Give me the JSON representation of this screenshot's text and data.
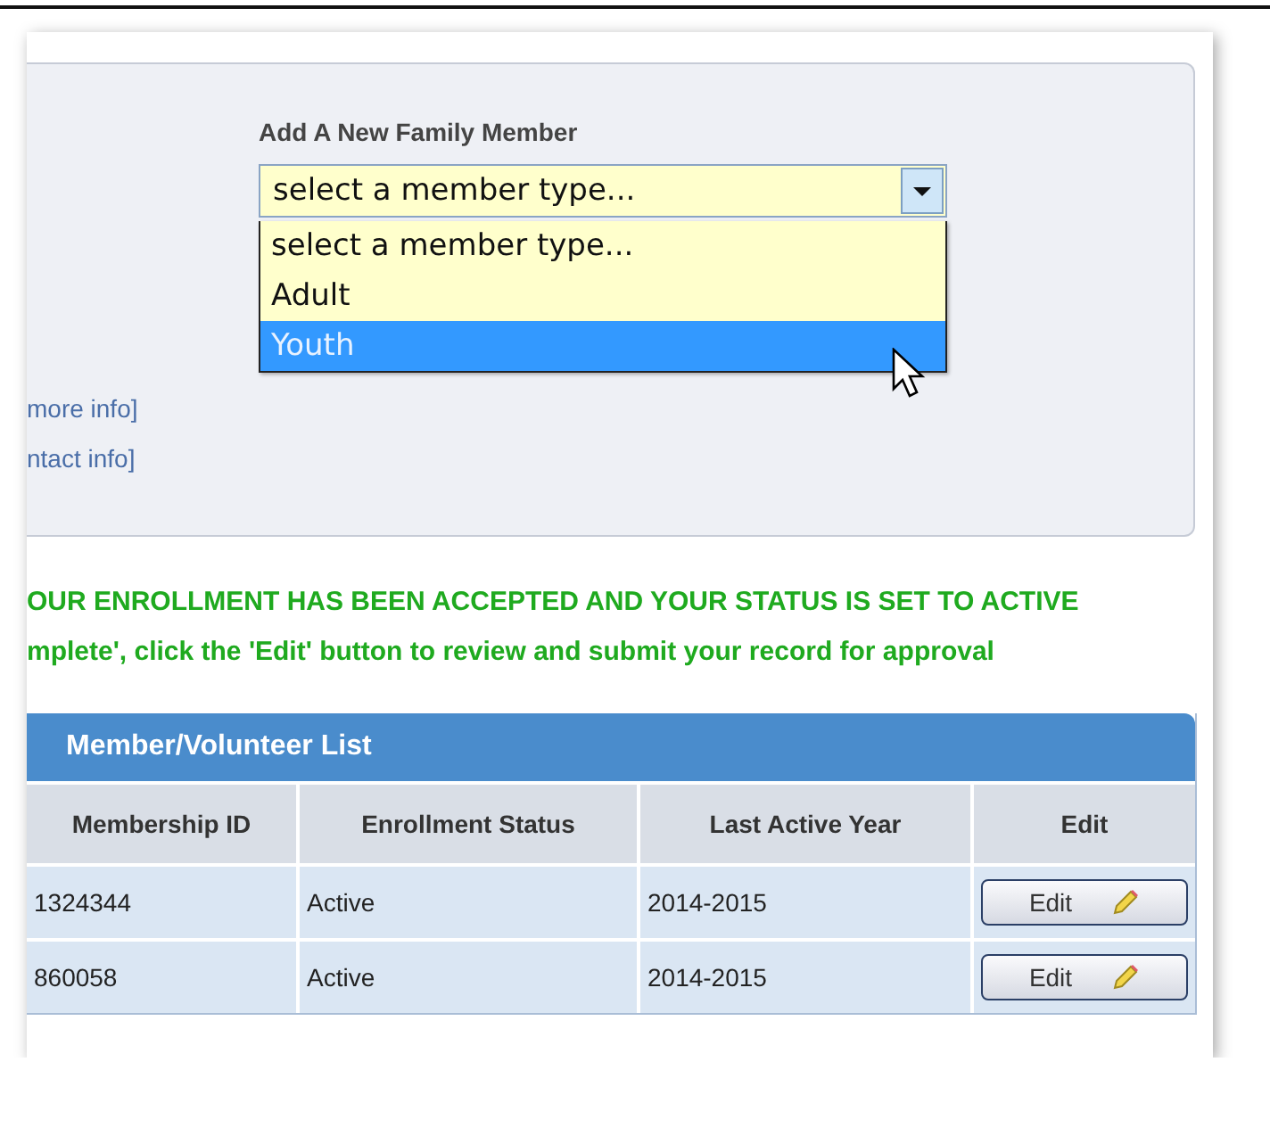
{
  "family_panel": {
    "label": "Add A New Family Member",
    "select": {
      "value": "select a member type...",
      "expanded": true,
      "options": [
        {
          "label": "select a member type...",
          "highlighted": false
        },
        {
          "label": "Adult",
          "highlighted": false
        },
        {
          "label": "Youth",
          "highlighted": true
        }
      ]
    },
    "links": [
      "more info]",
      "ntact info]"
    ]
  },
  "messages": [
    "OUR ENROLLMENT HAS BEEN ACCEPTED AND YOUR STATUS IS SET TO ACTIVE",
    "mplete', click the 'Edit' button to review and submit your record for approval"
  ],
  "table": {
    "title": "Member/Volunteer List",
    "columns": [
      "Membership ID",
      "Enrollment Status",
      "Last Active Year",
      "Edit"
    ],
    "rows": [
      {
        "cells": [
          "1324344",
          "Active",
          "2014-2015"
        ],
        "button": "Edit"
      },
      {
        "cells": [
          "860058",
          "Active",
          "2014-2015"
        ],
        "button": "Edit"
      }
    ]
  }
}
